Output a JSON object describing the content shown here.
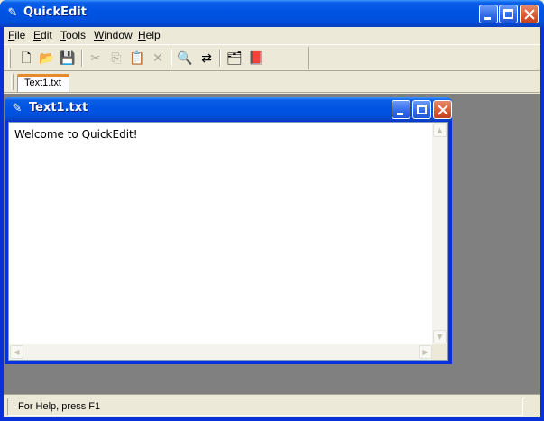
{
  "app": {
    "title": "QuickEdit",
    "icon": "quickedit-app-icon"
  },
  "menu": {
    "items": [
      {
        "label": "File",
        "accel": "F",
        "rest": "ile"
      },
      {
        "label": "Edit",
        "accel": "E",
        "rest": "dit"
      },
      {
        "label": "Tools",
        "accel": "T",
        "rest": "ools"
      },
      {
        "label": "Window",
        "accel": "W",
        "rest": "indow"
      },
      {
        "label": "Help",
        "accel": "H",
        "rest": "elp"
      }
    ]
  },
  "toolbar": {
    "buttons": [
      {
        "name": "new-file-icon",
        "glyph": "🗋",
        "enabled": true
      },
      {
        "name": "open-folder-icon",
        "glyph": "📂",
        "enabled": true
      },
      {
        "name": "save-icon",
        "glyph": "💾",
        "enabled": true
      },
      {
        "name": "cut-icon",
        "glyph": "✂",
        "enabled": false
      },
      {
        "name": "copy-icon",
        "glyph": "⎘",
        "enabled": false
      },
      {
        "name": "paste-icon",
        "glyph": "📋",
        "enabled": true
      },
      {
        "name": "delete-icon",
        "glyph": "✕",
        "enabled": false
      },
      {
        "name": "find-icon",
        "glyph": "🔍",
        "enabled": true
      },
      {
        "name": "replace-icon",
        "glyph": "⇄",
        "enabled": true
      },
      {
        "name": "properties-icon",
        "glyph": "🗂",
        "enabled": true
      },
      {
        "name": "help-book-icon",
        "glyph": "📕",
        "enabled": true
      }
    ]
  },
  "tabs": [
    {
      "label": "Text1.txt",
      "active": true
    }
  ],
  "document": {
    "title": "Text1.txt",
    "content": "Welcome to QuickEdit!"
  },
  "status": {
    "text": "For Help, press F1"
  },
  "colors": {
    "titlebar": "#0054e3",
    "close_button": "#d65a31",
    "tab_accent": "#e68b2c",
    "mdi_background": "#808080",
    "chrome": "#ece9d8"
  }
}
